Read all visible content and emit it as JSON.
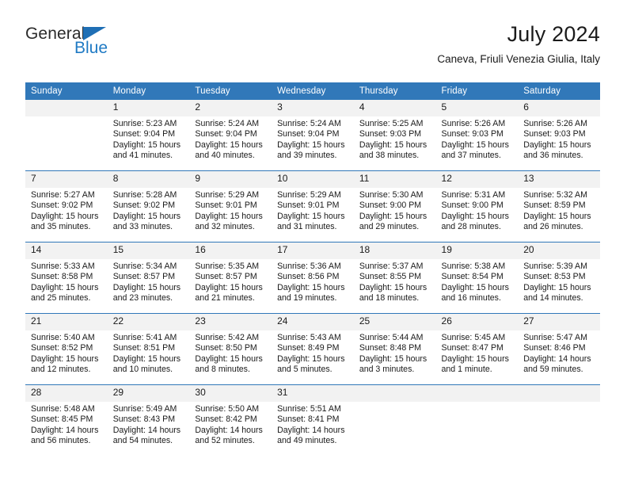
{
  "brand": {
    "name_top": "General",
    "name_bottom": "Blue",
    "accent_color": "#1f7ac4",
    "triangle_color": "#1f6fb5"
  },
  "header": {
    "title": "July 2024",
    "subtitle": "Caneva, Friuli Venezia Giulia, Italy"
  },
  "theme": {
    "header_bg": "#3178b9",
    "daynum_bg": "#f2f2f2",
    "text_color": "#1a1a1a"
  },
  "weekday_headers": [
    "Sunday",
    "Monday",
    "Tuesday",
    "Wednesday",
    "Thursday",
    "Friday",
    "Saturday"
  ],
  "weeks": [
    [
      {
        "day": "",
        "sunrise": "",
        "sunset": "",
        "daylight_line1": "",
        "daylight_line2": ""
      },
      {
        "day": "1",
        "sunrise": "Sunrise: 5:23 AM",
        "sunset": "Sunset: 9:04 PM",
        "daylight_line1": "Daylight: 15 hours",
        "daylight_line2": "and 41 minutes."
      },
      {
        "day": "2",
        "sunrise": "Sunrise: 5:24 AM",
        "sunset": "Sunset: 9:04 PM",
        "daylight_line1": "Daylight: 15 hours",
        "daylight_line2": "and 40 minutes."
      },
      {
        "day": "3",
        "sunrise": "Sunrise: 5:24 AM",
        "sunset": "Sunset: 9:04 PM",
        "daylight_line1": "Daylight: 15 hours",
        "daylight_line2": "and 39 minutes."
      },
      {
        "day": "4",
        "sunrise": "Sunrise: 5:25 AM",
        "sunset": "Sunset: 9:03 PM",
        "daylight_line1": "Daylight: 15 hours",
        "daylight_line2": "and 38 minutes."
      },
      {
        "day": "5",
        "sunrise": "Sunrise: 5:26 AM",
        "sunset": "Sunset: 9:03 PM",
        "daylight_line1": "Daylight: 15 hours",
        "daylight_line2": "and 37 minutes."
      },
      {
        "day": "6",
        "sunrise": "Sunrise: 5:26 AM",
        "sunset": "Sunset: 9:03 PM",
        "daylight_line1": "Daylight: 15 hours",
        "daylight_line2": "and 36 minutes."
      }
    ],
    [
      {
        "day": "7",
        "sunrise": "Sunrise: 5:27 AM",
        "sunset": "Sunset: 9:02 PM",
        "daylight_line1": "Daylight: 15 hours",
        "daylight_line2": "and 35 minutes."
      },
      {
        "day": "8",
        "sunrise": "Sunrise: 5:28 AM",
        "sunset": "Sunset: 9:02 PM",
        "daylight_line1": "Daylight: 15 hours",
        "daylight_line2": "and 33 minutes."
      },
      {
        "day": "9",
        "sunrise": "Sunrise: 5:29 AM",
        "sunset": "Sunset: 9:01 PM",
        "daylight_line1": "Daylight: 15 hours",
        "daylight_line2": "and 32 minutes."
      },
      {
        "day": "10",
        "sunrise": "Sunrise: 5:29 AM",
        "sunset": "Sunset: 9:01 PM",
        "daylight_line1": "Daylight: 15 hours",
        "daylight_line2": "and 31 minutes."
      },
      {
        "day": "11",
        "sunrise": "Sunrise: 5:30 AM",
        "sunset": "Sunset: 9:00 PM",
        "daylight_line1": "Daylight: 15 hours",
        "daylight_line2": "and 29 minutes."
      },
      {
        "day": "12",
        "sunrise": "Sunrise: 5:31 AM",
        "sunset": "Sunset: 9:00 PM",
        "daylight_line1": "Daylight: 15 hours",
        "daylight_line2": "and 28 minutes."
      },
      {
        "day": "13",
        "sunrise": "Sunrise: 5:32 AM",
        "sunset": "Sunset: 8:59 PM",
        "daylight_line1": "Daylight: 15 hours",
        "daylight_line2": "and 26 minutes."
      }
    ],
    [
      {
        "day": "14",
        "sunrise": "Sunrise: 5:33 AM",
        "sunset": "Sunset: 8:58 PM",
        "daylight_line1": "Daylight: 15 hours",
        "daylight_line2": "and 25 minutes."
      },
      {
        "day": "15",
        "sunrise": "Sunrise: 5:34 AM",
        "sunset": "Sunset: 8:57 PM",
        "daylight_line1": "Daylight: 15 hours",
        "daylight_line2": "and 23 minutes."
      },
      {
        "day": "16",
        "sunrise": "Sunrise: 5:35 AM",
        "sunset": "Sunset: 8:57 PM",
        "daylight_line1": "Daylight: 15 hours",
        "daylight_line2": "and 21 minutes."
      },
      {
        "day": "17",
        "sunrise": "Sunrise: 5:36 AM",
        "sunset": "Sunset: 8:56 PM",
        "daylight_line1": "Daylight: 15 hours",
        "daylight_line2": "and 19 minutes."
      },
      {
        "day": "18",
        "sunrise": "Sunrise: 5:37 AM",
        "sunset": "Sunset: 8:55 PM",
        "daylight_line1": "Daylight: 15 hours",
        "daylight_line2": "and 18 minutes."
      },
      {
        "day": "19",
        "sunrise": "Sunrise: 5:38 AM",
        "sunset": "Sunset: 8:54 PM",
        "daylight_line1": "Daylight: 15 hours",
        "daylight_line2": "and 16 minutes."
      },
      {
        "day": "20",
        "sunrise": "Sunrise: 5:39 AM",
        "sunset": "Sunset: 8:53 PM",
        "daylight_line1": "Daylight: 15 hours",
        "daylight_line2": "and 14 minutes."
      }
    ],
    [
      {
        "day": "21",
        "sunrise": "Sunrise: 5:40 AM",
        "sunset": "Sunset: 8:52 PM",
        "daylight_line1": "Daylight: 15 hours",
        "daylight_line2": "and 12 minutes."
      },
      {
        "day": "22",
        "sunrise": "Sunrise: 5:41 AM",
        "sunset": "Sunset: 8:51 PM",
        "daylight_line1": "Daylight: 15 hours",
        "daylight_line2": "and 10 minutes."
      },
      {
        "day": "23",
        "sunrise": "Sunrise: 5:42 AM",
        "sunset": "Sunset: 8:50 PM",
        "daylight_line1": "Daylight: 15 hours",
        "daylight_line2": "and 8 minutes."
      },
      {
        "day": "24",
        "sunrise": "Sunrise: 5:43 AM",
        "sunset": "Sunset: 8:49 PM",
        "daylight_line1": "Daylight: 15 hours",
        "daylight_line2": "and 5 minutes."
      },
      {
        "day": "25",
        "sunrise": "Sunrise: 5:44 AM",
        "sunset": "Sunset: 8:48 PM",
        "daylight_line1": "Daylight: 15 hours",
        "daylight_line2": "and 3 minutes."
      },
      {
        "day": "26",
        "sunrise": "Sunrise: 5:45 AM",
        "sunset": "Sunset: 8:47 PM",
        "daylight_line1": "Daylight: 15 hours",
        "daylight_line2": "and 1 minute."
      },
      {
        "day": "27",
        "sunrise": "Sunrise: 5:47 AM",
        "sunset": "Sunset: 8:46 PM",
        "daylight_line1": "Daylight: 14 hours",
        "daylight_line2": "and 59 minutes."
      }
    ],
    [
      {
        "day": "28",
        "sunrise": "Sunrise: 5:48 AM",
        "sunset": "Sunset: 8:45 PM",
        "daylight_line1": "Daylight: 14 hours",
        "daylight_line2": "and 56 minutes."
      },
      {
        "day": "29",
        "sunrise": "Sunrise: 5:49 AM",
        "sunset": "Sunset: 8:43 PM",
        "daylight_line1": "Daylight: 14 hours",
        "daylight_line2": "and 54 minutes."
      },
      {
        "day": "30",
        "sunrise": "Sunrise: 5:50 AM",
        "sunset": "Sunset: 8:42 PM",
        "daylight_line1": "Daylight: 14 hours",
        "daylight_line2": "and 52 minutes."
      },
      {
        "day": "31",
        "sunrise": "Sunrise: 5:51 AM",
        "sunset": "Sunset: 8:41 PM",
        "daylight_line1": "Daylight: 14 hours",
        "daylight_line2": "and 49 minutes."
      },
      {
        "day": "",
        "sunrise": "",
        "sunset": "",
        "daylight_line1": "",
        "daylight_line2": ""
      },
      {
        "day": "",
        "sunrise": "",
        "sunset": "",
        "daylight_line1": "",
        "daylight_line2": ""
      },
      {
        "day": "",
        "sunrise": "",
        "sunset": "",
        "daylight_line1": "",
        "daylight_line2": ""
      }
    ]
  ]
}
